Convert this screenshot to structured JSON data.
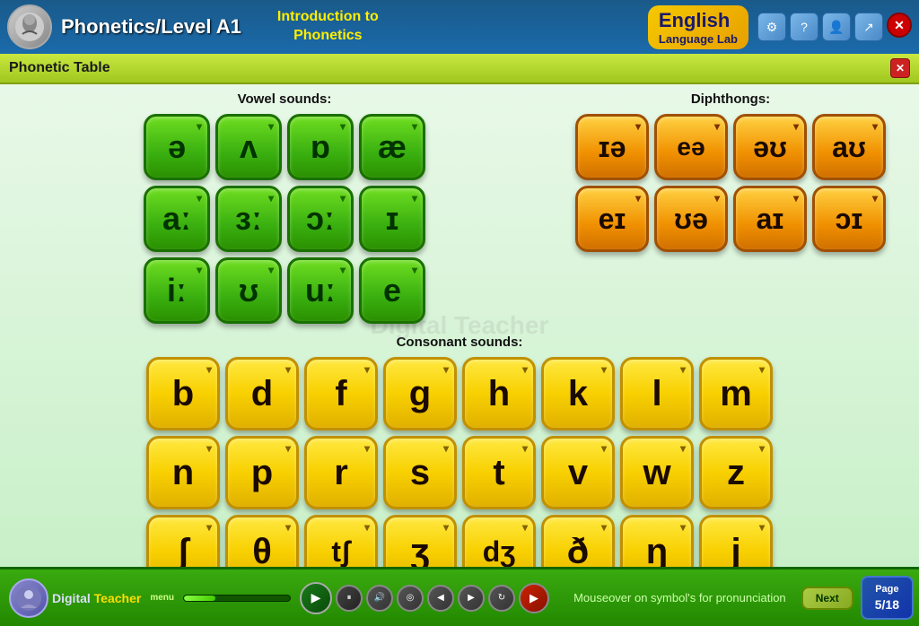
{
  "topbar": {
    "title": "Phonetics/Level A1",
    "subtitle_line1": "Introduction to",
    "subtitle_line2": "Phonetics",
    "english_text": "English",
    "lab_text": "Language Lab",
    "close_label": "✕"
  },
  "phonetic_table": {
    "title": "Phonetic Table",
    "close_label": "✕"
  },
  "vowel_section": {
    "label": "Vowel sounds:",
    "row1": [
      "ə",
      "ʌ",
      "ɒ",
      "æ"
    ],
    "row2": [
      "aː",
      "ɜː",
      "ɔː",
      "ɪ"
    ],
    "row3": [
      "iː",
      "ʊ",
      "uː",
      "e"
    ]
  },
  "diphthong_section": {
    "label": "Diphthongs:",
    "row1": [
      "ɪə",
      "eə",
      "əʊ",
      "aʊ"
    ],
    "row2": [
      "eɪ",
      "ʊə",
      "aɪ",
      "ɔɪ"
    ]
  },
  "consonant_section": {
    "label": "Consonant sounds:",
    "row1": [
      "b",
      "d",
      "f",
      "g",
      "h",
      "k",
      "l",
      "m"
    ],
    "row2": [
      "n",
      "p",
      "r",
      "s",
      "t",
      "v",
      "w",
      "z"
    ],
    "row3": [
      "ʃ",
      "θ",
      "tʃ",
      "ʒ",
      "dʒ",
      "ð",
      "ŋ",
      "j"
    ]
  },
  "bottom": {
    "status": "Mouseover on symbol's for  pronunciation",
    "next_label": "Next",
    "page_label": "Page",
    "page_num": "5/18",
    "menu_label": "menu"
  }
}
